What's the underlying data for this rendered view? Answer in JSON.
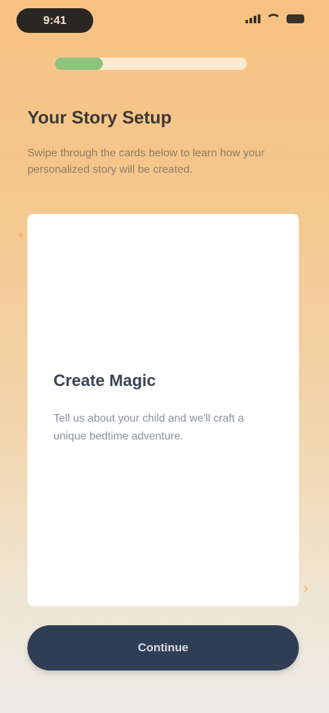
{
  "status_bar": {
    "time": "9:41"
  },
  "progress": {
    "fraction": 0.25
  },
  "header": {
    "title": "Your Story Setup",
    "subtitle": "Swipe through the cards below to learn how your personalized story will be created."
  },
  "card": {
    "heading": "Create Magic",
    "body": "Tell us about your child and we'll craft a unique bedtime adventure."
  },
  "actions": {
    "continue_label": "Continue"
  },
  "colors": {
    "progress_fill": "#8cc37d",
    "button_bg": "#2f3e55",
    "accent": "#f0b27a"
  },
  "icons": {
    "swipe_hint": "chevron-right-icon",
    "card_mark": "sparkle-icon"
  }
}
